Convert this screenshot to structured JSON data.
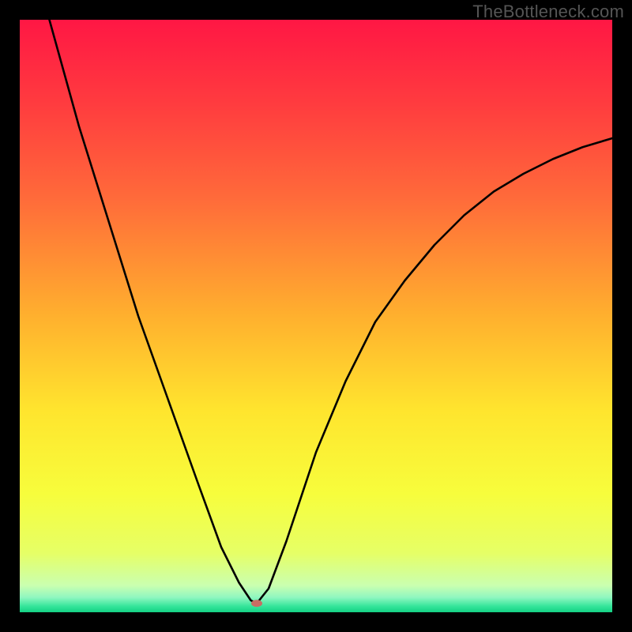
{
  "watermark": "TheBottleneck.com",
  "chart_data": {
    "type": "line",
    "title": "",
    "xlabel": "",
    "ylabel": "",
    "xlim": [
      0,
      100
    ],
    "ylim": [
      0,
      100
    ],
    "notch_x": 40,
    "notch_y": 1.5,
    "gradient_stops": [
      {
        "offset": 0.0,
        "color": "#ff1744"
      },
      {
        "offset": 0.14,
        "color": "#ff3b3f"
      },
      {
        "offset": 0.3,
        "color": "#ff6a3a"
      },
      {
        "offset": 0.5,
        "color": "#ffb02e"
      },
      {
        "offset": 0.66,
        "color": "#ffe52e"
      },
      {
        "offset": 0.8,
        "color": "#f7fd3c"
      },
      {
        "offset": 0.9,
        "color": "#e6ff66"
      },
      {
        "offset": 0.955,
        "color": "#caffb0"
      },
      {
        "offset": 0.975,
        "color": "#8ff7c0"
      },
      {
        "offset": 0.99,
        "color": "#35e59a"
      },
      {
        "offset": 1.0,
        "color": "#14d184"
      }
    ],
    "curve_left": [
      {
        "x": 5,
        "y": 100
      },
      {
        "x": 10,
        "y": 82
      },
      {
        "x": 15,
        "y": 66
      },
      {
        "x": 20,
        "y": 50
      },
      {
        "x": 25,
        "y": 36
      },
      {
        "x": 30,
        "y": 22
      },
      {
        "x": 34,
        "y": 11
      },
      {
        "x": 37,
        "y": 5
      },
      {
        "x": 39,
        "y": 2
      },
      {
        "x": 40,
        "y": 1.5
      }
    ],
    "curve_right": [
      {
        "x": 40,
        "y": 1.5
      },
      {
        "x": 42,
        "y": 4
      },
      {
        "x": 45,
        "y": 12
      },
      {
        "x": 50,
        "y": 27
      },
      {
        "x": 55,
        "y": 39
      },
      {
        "x": 60,
        "y": 49
      },
      {
        "x": 65,
        "y": 56
      },
      {
        "x": 70,
        "y": 62
      },
      {
        "x": 75,
        "y": 67
      },
      {
        "x": 80,
        "y": 71
      },
      {
        "x": 85,
        "y": 74
      },
      {
        "x": 90,
        "y": 76.5
      },
      {
        "x": 95,
        "y": 78.5
      },
      {
        "x": 100,
        "y": 80
      }
    ],
    "marker": {
      "x": 40,
      "y": 1.5,
      "rx": 7,
      "ry": 4.5,
      "color": "#c96d63"
    }
  }
}
